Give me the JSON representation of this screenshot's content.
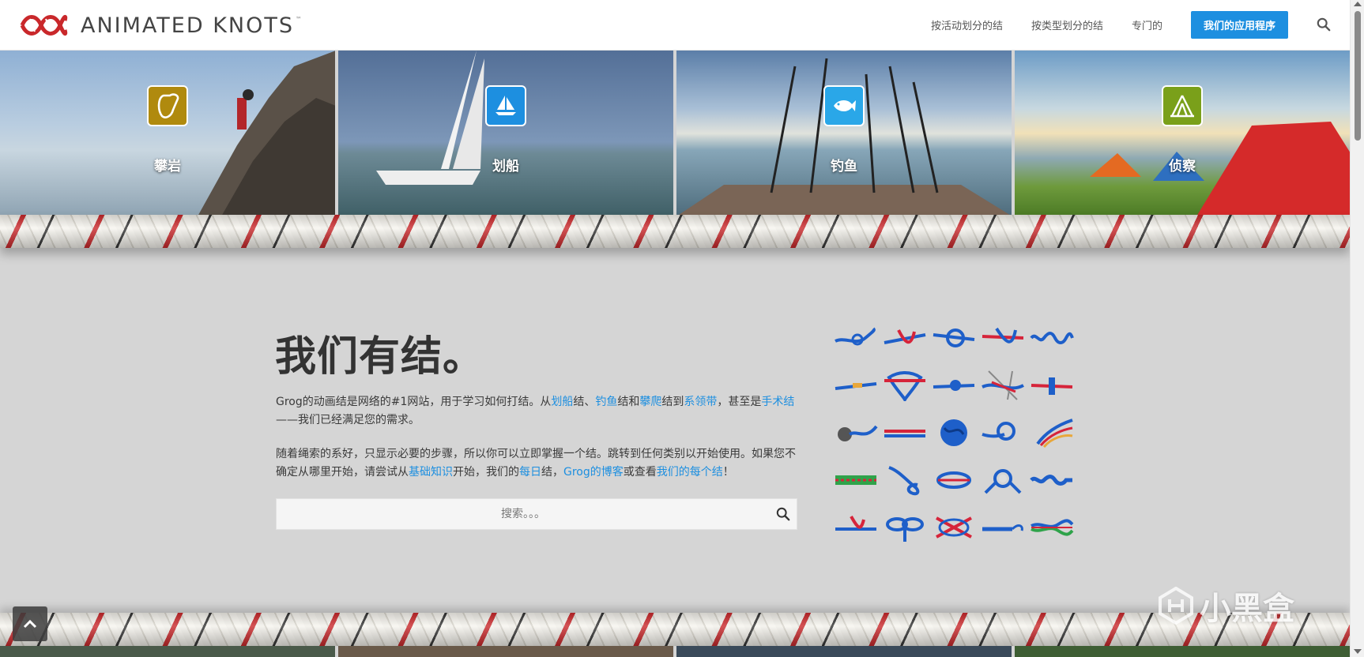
{
  "header": {
    "logo_text": "ANIMATED KNOTS",
    "logo_tm": "™",
    "nav": {
      "by_activity": "按活动划分的结",
      "by_type": "按类型划分的结",
      "special": "专门的",
      "apps": "我们的应用程序"
    }
  },
  "tiles": [
    {
      "label": "攀岩",
      "icon": "carabiner-icon",
      "color": "#b08a0e"
    },
    {
      "label": "划船",
      "icon": "sailboat-icon",
      "color": "#1d8fe0"
    },
    {
      "label": "钓鱼",
      "icon": "fish-icon",
      "color": "#2aa7e8"
    },
    {
      "label": "侦察",
      "icon": "tent-icon",
      "color": "#7aa01a"
    }
  ],
  "main": {
    "headline": "我们有结。",
    "para1": {
      "t1": "Grog的动画结是网络的#1网站，用于学习如何打结。从",
      "l1": "划船",
      "t2": "结、",
      "l2": "钓鱼",
      "t3": "结和",
      "l3": "攀爬",
      "t4": "结到",
      "l4": "系领带",
      "t5": "，甚至是",
      "l5": "手术结",
      "t6": "——我们已经满足您的需求。"
    },
    "para2": {
      "t1": "随着绳索的系好，只显示必要的步骤，所以你可以立即掌握一个结。跳转到任何类别以开始使用。如果您不确定从哪里开始，请尝试从",
      "l1": "基础知识",
      "t2": "开始，我们的",
      "l2": "每日",
      "t3": "结，",
      "l3": "Grog的博客",
      "t4": "或查看",
      "l4": "我们的每个结",
      "t5": "！"
    },
    "search_placeholder": "搜索。。。"
  },
  "watermark": "小黑盒",
  "colors": {
    "accent": "#1d8fe0",
    "rope_red": "#c9282b",
    "knot_blue": "#1e5fc9",
    "knot_red": "#d6243a"
  }
}
